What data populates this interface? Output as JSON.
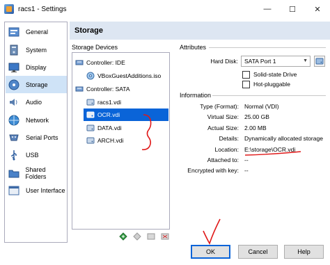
{
  "window": {
    "title": "racs1 - Settings",
    "minimize_glyph": "—",
    "maximize_glyph": "☐",
    "close_glyph": "✕"
  },
  "sidebar": {
    "items": [
      {
        "label": "General",
        "icon": "general-icon"
      },
      {
        "label": "System",
        "icon": "system-icon"
      },
      {
        "label": "Display",
        "icon": "display-icon"
      },
      {
        "label": "Storage",
        "icon": "storage-icon",
        "selected": true
      },
      {
        "label": "Audio",
        "icon": "audio-icon"
      },
      {
        "label": "Network",
        "icon": "network-icon"
      },
      {
        "label": "Serial Ports",
        "icon": "serial-ports-icon"
      },
      {
        "label": "USB",
        "icon": "usb-icon"
      },
      {
        "label": "Shared Folders",
        "icon": "shared-folders-icon"
      },
      {
        "label": "User Interface",
        "icon": "user-interface-icon"
      }
    ]
  },
  "header": {
    "title": "Storage"
  },
  "storage": {
    "group_label": "Storage Devices",
    "tree": [
      {
        "label": "Controller: IDE",
        "level": 0,
        "icon": "ide-controller-icon"
      },
      {
        "label": "VBoxGuestAdditions.iso",
        "level": 1,
        "icon": "optical-disc-icon"
      },
      {
        "label": "Controller: SATA",
        "level": 0,
        "icon": "sata-controller-icon"
      },
      {
        "label": "racs1.vdi",
        "level": 1,
        "icon": "hard-disk-icon"
      },
      {
        "label": "OCR.vdi",
        "level": 1,
        "icon": "hard-disk-icon",
        "selected": true
      },
      {
        "label": "DATA.vdi",
        "level": 1,
        "icon": "hard-disk-icon"
      },
      {
        "label": "ARCH.vdi",
        "level": 1,
        "icon": "hard-disk-icon"
      }
    ]
  },
  "attributes": {
    "group_label": "Attributes",
    "hard_disk_label": "Hard Disk:",
    "hard_disk_value": "SATA Port 1",
    "solid_state_label": "Solid-state Drive",
    "solid_state_checked": false,
    "hot_pluggable_label": "Hot-pluggable",
    "hot_pluggable_checked": false
  },
  "information": {
    "group_label": "Information",
    "rows": [
      {
        "label": "Type (Format):",
        "value": "Normal (VDI)"
      },
      {
        "label": "Virtual Size:",
        "value": "25.00 GB"
      },
      {
        "label": "Actual Size:",
        "value": "2.00 MB"
      },
      {
        "label": "Details:",
        "value": "Dynamically allocated storage"
      },
      {
        "label": "Location:",
        "value": "E:\\storage\\OCR.vdi"
      },
      {
        "label": "Attached to:",
        "value": "--"
      },
      {
        "label": "Encrypted with key:",
        "value": "--"
      }
    ]
  },
  "buttons": {
    "ok": "OK",
    "cancel": "Cancel",
    "help": "Help"
  },
  "colors": {
    "selection": "#0a64d8",
    "annotation_red": "#e01818",
    "header_bg": "#dde6f2"
  }
}
